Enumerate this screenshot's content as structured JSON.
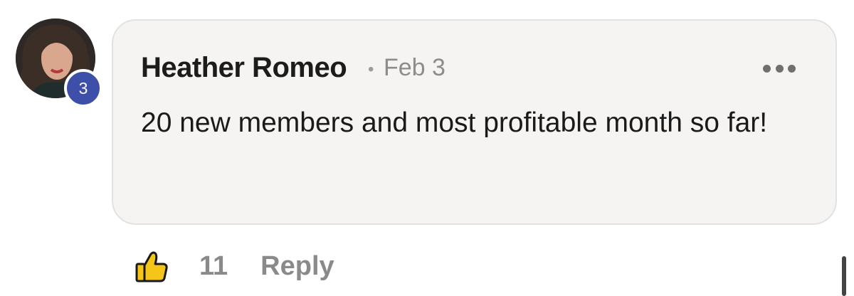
{
  "comment": {
    "author": "Heather Romeo",
    "separator": "•",
    "date": "Feb 3",
    "text": "20 new members and most profitable month so far!",
    "level": "3",
    "more_icon": "more-horizontal-icon"
  },
  "actions": {
    "like_icon": "thumbs-up-icon",
    "like_count": "11",
    "reply_label": "Reply"
  },
  "colors": {
    "card_background": "#f5f4f2",
    "level_badge": "#3d4fa8",
    "like_icon_fill": "#f5c518",
    "muted_text": "#8a8a8a"
  }
}
